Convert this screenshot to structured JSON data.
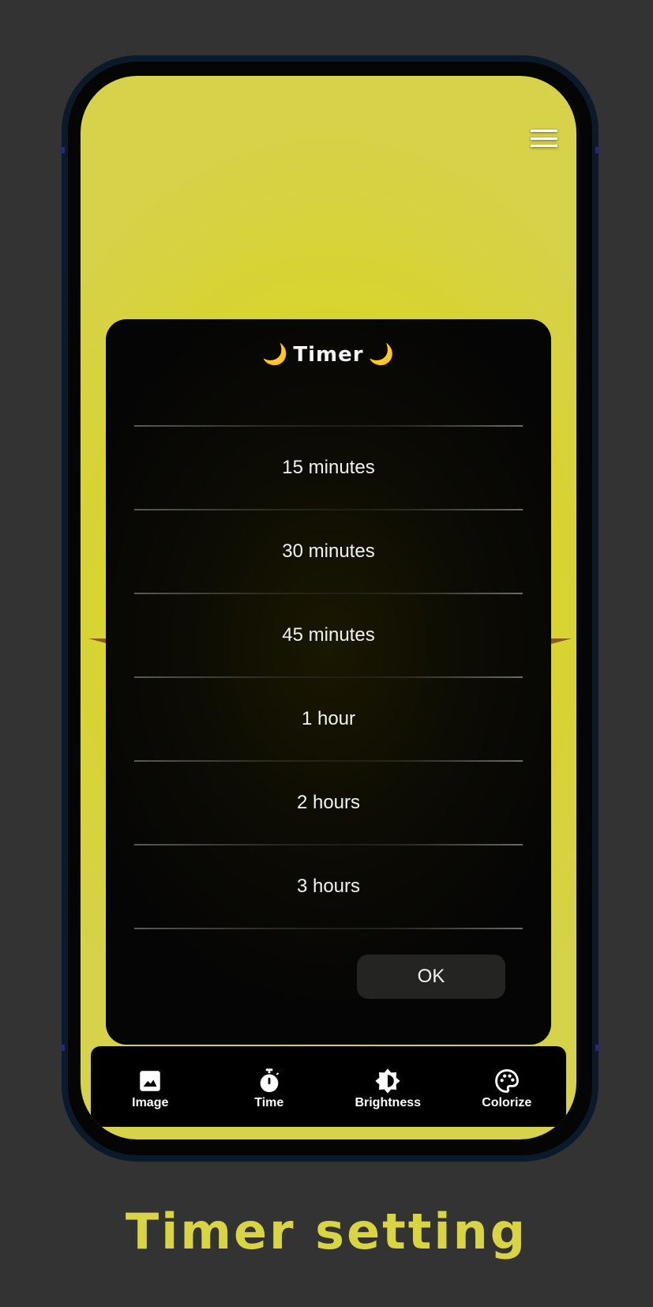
{
  "app": {
    "menu_icon": "hamburger-menu-icon"
  },
  "dialog": {
    "title_icon": "crescent-moon-emoji",
    "title_moon_left": "🌙",
    "title_text": "Timer",
    "title_moon_right": "🌙",
    "options": [
      {
        "label": "15 minutes"
      },
      {
        "label": "30 minutes"
      },
      {
        "label": "45 minutes"
      },
      {
        "label": "1 hour"
      },
      {
        "label": "2 hours"
      },
      {
        "label": "3 hours"
      }
    ],
    "ok_label": "OK"
  },
  "bottom_nav": {
    "items": [
      {
        "label": "Image",
        "icon": "image-icon"
      },
      {
        "label": "Time",
        "icon": "stopwatch-icon"
      },
      {
        "label": "Brightness",
        "icon": "brightness-icon"
      },
      {
        "label": "Colorize",
        "icon": "palette-icon"
      }
    ]
  },
  "caption": "Timer setting",
  "colors": {
    "accent_yellow": "#d8d442",
    "screen_yellow": "#dcd800",
    "dialog_bg": "#0c0b04",
    "ok_button_bg": "#242422",
    "page_bg": "#333333"
  }
}
